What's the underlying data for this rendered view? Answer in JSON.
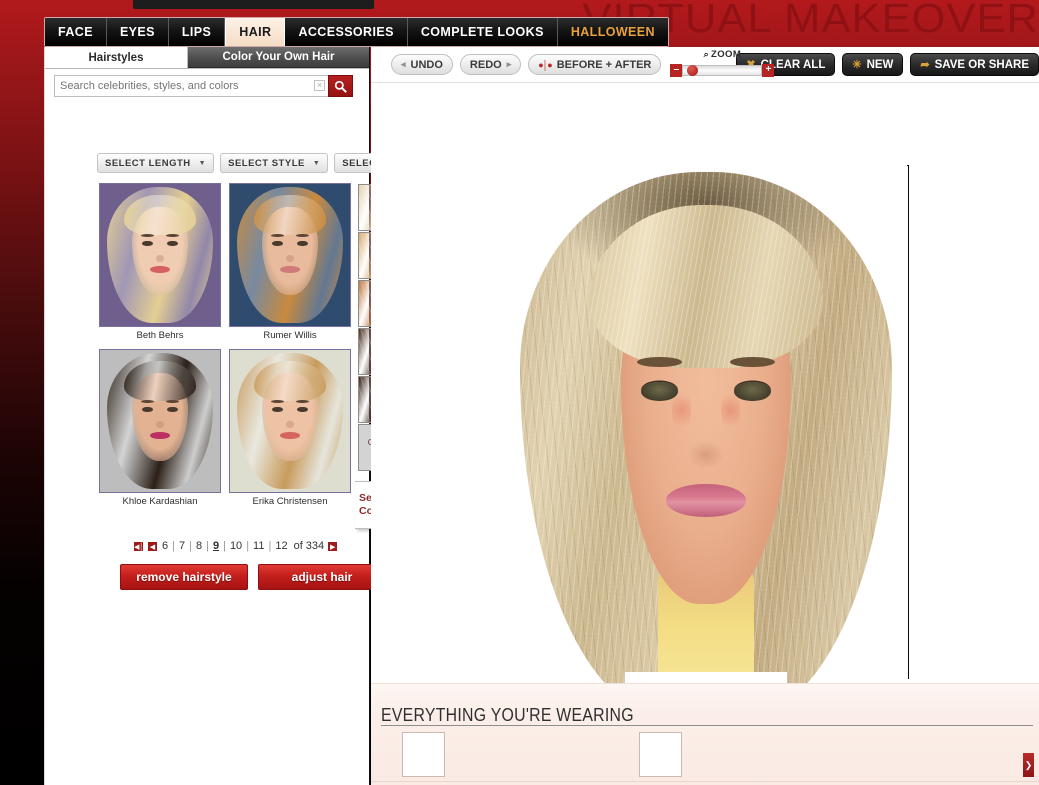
{
  "brand": {
    "wordmark": "VIRTUAL MAKEOVER"
  },
  "tabs": [
    {
      "label": "FACE",
      "active": false
    },
    {
      "label": "EYES",
      "active": false
    },
    {
      "label": "LIPS",
      "active": false
    },
    {
      "label": "HAIR",
      "active": true
    },
    {
      "label": "ACCESSORIES",
      "active": false
    },
    {
      "label": "COMPLETE LOOKS",
      "active": false
    },
    {
      "label": "HALLOWEEN",
      "active": false,
      "accent": true
    }
  ],
  "left_panel": {
    "tabs": [
      {
        "label": "Hairstyles",
        "selected": true
      },
      {
        "label": "Color Your Own Hair",
        "selected": false
      }
    ],
    "search": {
      "placeholder": "Search celebrities, styles, and colors",
      "value": "",
      "clear_label": "×",
      "button_icon": "search-icon"
    },
    "filters": [
      {
        "label": "SELECT LENGTH",
        "caret": "▼"
      },
      {
        "label": "SELECT STYLE",
        "caret": "▼"
      },
      {
        "label": "SELECT COLOR",
        "caret": "▼"
      }
    ],
    "thumbnails": [
      {
        "name": "Beth Behrs",
        "bg": "#6e5f8d",
        "hair": "#e4cf92",
        "skin": "#f0cdb2",
        "lips": "#d4605f"
      },
      {
        "name": "Rumer Willis",
        "bg": "#2f4b6e",
        "hair": "#c98a3e",
        "skin": "#e8bb9c",
        "lips": "#cf7b79"
      },
      {
        "name": "Khloe Kardashian",
        "bg": "#bdbdbd",
        "hair": "#2b2018",
        "skin": "#e3b293",
        "lips": "#bd2f62"
      },
      {
        "name": "Erika Christensen",
        "bg": "#ddddd0",
        "hair": "#c89b5c",
        "skin": "#eec2a4",
        "lips": "#d4645e"
      }
    ],
    "swatches": [
      {
        "name": "light-blonde",
        "color": "#e6cfa8",
        "label": ""
      },
      {
        "name": "golden-blonde",
        "color": "#d8a86a",
        "label": ""
      },
      {
        "name": "copper-auburn",
        "color": "#bd7338",
        "label": ""
      },
      {
        "name": "dark-brown",
        "color": "#4a2c1c",
        "label": ""
      },
      {
        "name": "darkest-brown",
        "color": "#3a2015",
        "label": ""
      },
      {
        "name": "original-color",
        "color": "#d3d3d3",
        "label": "Original Color"
      }
    ],
    "see_all_colors": {
      "label": "See All Colors",
      "arrow": "»"
    },
    "pagination": {
      "first_icon": "◀│",
      "prev_icon": "◀",
      "next_icon": "▶",
      "pages": [
        "6",
        "7",
        "8",
        "9",
        "10",
        "11",
        "12"
      ],
      "current": "9",
      "separator": "|",
      "total_text": "of 334"
    },
    "actions": [
      {
        "label": "remove hairstyle"
      },
      {
        "label": "adjust hair"
      }
    ]
  },
  "toolbar": {
    "undo": {
      "label": "UNDO",
      "icon": "◂"
    },
    "redo": {
      "label": "REDO",
      "icon": "▸"
    },
    "before_after": {
      "label": "BEFORE + AFTER",
      "icon": "●│●"
    },
    "zoom": {
      "label": "ZOOM",
      "magnifier": "⌕",
      "minus": "–",
      "plus": "+",
      "value": 8
    },
    "clear_all": {
      "label": "CLEAR ALL",
      "icon": "✖"
    },
    "new": {
      "label": "NEW",
      "icon": "✳"
    },
    "save_or_share": {
      "label": "SAVE OR SHARE",
      "icon": "➦"
    }
  },
  "bottom_panel": {
    "title": "EVERYTHING YOU'RE WEARING",
    "slots": [
      "",
      ""
    ],
    "scroll_arrow": "❯"
  },
  "colors": {
    "brand_red": "#9e1a1a",
    "accent_gold": "#e8a13c",
    "button_red": "#c41f1c",
    "panel_pink": "#faeae3"
  }
}
